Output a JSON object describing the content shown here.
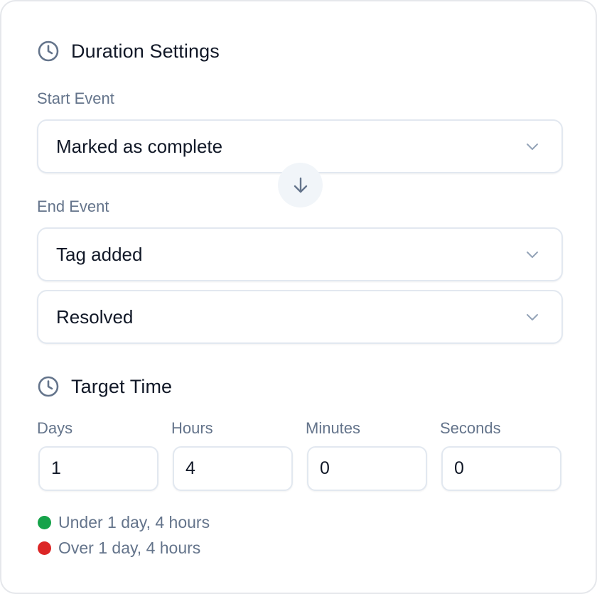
{
  "duration_settings": {
    "title": "Duration Settings",
    "icon": "clock-icon",
    "start_event": {
      "label": "Start Event",
      "value": "Marked as complete"
    },
    "arrow_icon": "arrow-down-icon",
    "end_event": {
      "label": "End Event",
      "value": "Tag added",
      "secondary_value": "Resolved"
    }
  },
  "target_time": {
    "title": "Target Time",
    "icon": "clock-icon",
    "fields": [
      {
        "label": "Days",
        "value": "1"
      },
      {
        "label": "Hours",
        "value": "4"
      },
      {
        "label": "Minutes",
        "value": "0"
      },
      {
        "label": "Seconds",
        "value": "0"
      }
    ]
  },
  "legend": [
    {
      "text": "Under 1 day, 4 hours",
      "color": "#16a34a"
    },
    {
      "text": "Over 1 day, 4 hours",
      "color": "#dc2626"
    }
  ],
  "colors": {
    "icon": "#64748b",
    "label": "#64748b",
    "border": "#e2e8f0",
    "heading": "#111827"
  }
}
